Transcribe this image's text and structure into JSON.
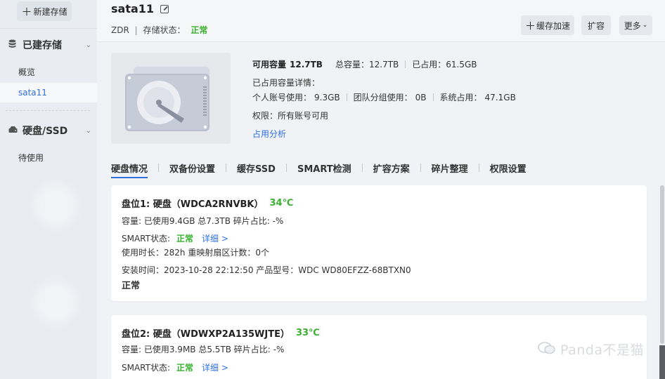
{
  "sidebar": {
    "new_button": "新建存储",
    "group1": "已建存储",
    "items1": [
      "概览",
      "sata11"
    ],
    "group2": "硬盘/SSD",
    "items2": [
      "待使用"
    ]
  },
  "header": {
    "title": "sata11",
    "zdr": "ZDR",
    "status_label": "存储状态：",
    "status_value": "正常",
    "btn_cache": "缓存加速",
    "btn_expand": "扩容",
    "btn_more": "更多"
  },
  "summary": {
    "avail_label": "可用容量",
    "avail_value": "12.7TB",
    "total_label": "总容量：",
    "total_value": "12.7TB",
    "used_label": "已占用：",
    "used_value": "61.5GB",
    "detail_title": "已占用容量详情：",
    "personal_label": "个人账号使用：",
    "personal_value": "9.3GB",
    "team_label": "团队分组使用：",
    "team_value": "0B",
    "system_label": "系统占用：",
    "system_value": "47.1GB",
    "perm_label": "权限：",
    "perm_value": "所有账号可用",
    "analysis_link": "占用分析"
  },
  "tabs": [
    "硬盘情况",
    "双备份设置",
    "缓存SSD",
    "SMART检测",
    "扩容方案",
    "碎片整理",
    "权限设置"
  ],
  "disks": [
    {
      "title": "盘位1:   硬盘（WDCA2RNVBK）",
      "temp": "34℃",
      "capacity": "容量:    已使用9.4GB 总7.3TB    碎片占比:   -%",
      "smart_label": "SMART状态:",
      "smart_value": "正常",
      "detail_link": "详细 >",
      "usage": "使用时长：282h 重映射扇区计数：0个",
      "install": "安装时间：2023-10-28 22:12:50 产品型号：WDC WD80EFZZ-68BTXN0",
      "status": "正常"
    },
    {
      "title": "盘位2:   硬盘（WDWXP2A135WJTE）",
      "temp": "33℃",
      "capacity": "容量:    已使用3.9MB 总5.5TB    碎片占比:   -%",
      "smart_label": "SMART状态:",
      "smart_value": "正常",
      "detail_link": "详细 >"
    }
  ],
  "watermark": "Panda不是猫"
}
